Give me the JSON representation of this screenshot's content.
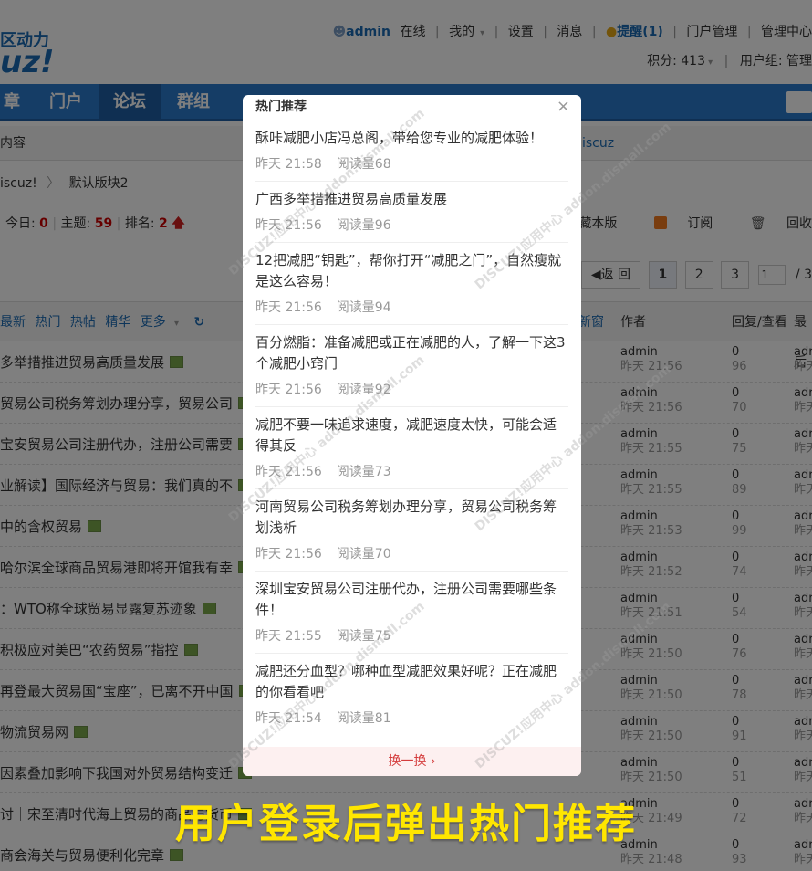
{
  "header": {
    "logo_top": "区动力",
    "logo_bottom": "uz!",
    "user": "admin",
    "status": "在线",
    "links": [
      "我的",
      "设置",
      "消息",
      "提醒(1)",
      "门户管理",
      "管理中心"
    ],
    "points": "积分: 413",
    "usergroup": "用户组: 管理"
  },
  "nav": {
    "items": [
      "章",
      "门户",
      "论坛",
      "群组"
    ],
    "sub": "内容",
    "sub_right": "iscuz"
  },
  "breadcrumb": [
    "iscuz!",
    "默认版块2"
  ],
  "stats": {
    "today_label": "今日:",
    "today": "0",
    "topics_label": "主题:",
    "topics": "59",
    "rank_label": "排名:",
    "rank": "2"
  },
  "actions": [
    "收藏本版",
    "订阅",
    "回收"
  ],
  "pager": {
    "back": "返 回",
    "pages": [
      "1",
      "2",
      "3"
    ],
    "input": "1",
    "total": "/ 3"
  },
  "list": {
    "filters": [
      "最新",
      "热门",
      "热帖",
      "精华",
      "更多"
    ],
    "cols": {
      "newwin": "新窗",
      "author": "作者",
      "replies": "回复/查看",
      "last": "最后"
    },
    "rows": [
      {
        "title": "多举措推进贸易高质量发展",
        "author": "admin",
        "time": "昨天 21:56",
        "r": "0",
        "v": "96",
        "last1": "adr",
        "last2": "昨天"
      },
      {
        "title": "贸易公司税务筹划办理分享，贸易公司",
        "author": "admin",
        "time": "昨天 21:56",
        "r": "0",
        "v": "70",
        "last1": "adr",
        "last2": "昨天"
      },
      {
        "title": "宝安贸易公司注册代办，注册公司需要",
        "author": "admin",
        "time": "昨天 21:55",
        "r": "0",
        "v": "75",
        "last1": "adr",
        "last2": "昨天"
      },
      {
        "title": "业解读】国际经济与贸易：我们真的不",
        "author": "admin",
        "time": "昨天 21:55",
        "r": "0",
        "v": "89",
        "last1": "adr",
        "last2": "昨天"
      },
      {
        "title": "中的含权贸易",
        "author": "admin",
        "time": "昨天 21:53",
        "r": "0",
        "v": "99",
        "last1": "adr",
        "last2": "昨天"
      },
      {
        "title": "哈尔滨全球商品贸易港即将开馆我有幸",
        "author": "admin",
        "time": "昨天 21:52",
        "r": "0",
        "v": "74",
        "last1": "adr",
        "last2": "昨天"
      },
      {
        "title": "：WTO称全球贸易显露复苏迹象",
        "author": "admin",
        "time": "昨天 21:51",
        "r": "0",
        "v": "54",
        "last1": "adr",
        "last2": "昨天"
      },
      {
        "title": "积极应对美巴“农药贸易”指控",
        "author": "admin",
        "time": "昨天 21:50",
        "r": "0",
        "v": "76",
        "last1": "adr",
        "last2": "昨天"
      },
      {
        "title": "再登最大贸易国“宝座”，已离不开中国",
        "author": "admin",
        "time": "昨天 21:50",
        "r": "0",
        "v": "78",
        "last1": "adr",
        "last2": "昨天"
      },
      {
        "title": "物流贸易网",
        "author": "admin",
        "time": "昨天 21:50",
        "r": "0",
        "v": "91",
        "last1": "adr",
        "last2": "昨天"
      },
      {
        "title": "因素叠加影响下我国对外贸易结构变迁",
        "author": "admin",
        "time": "昨天 21:50",
        "r": "0",
        "v": "51",
        "last1": "adr",
        "last2": "昨天"
      },
      {
        "title": "讨｜宋至清时代海上贸易的商品与货币",
        "author": "admin",
        "time": "昨天 21:49",
        "r": "0",
        "v": "72",
        "last1": "adr",
        "last2": "昨天"
      },
      {
        "title": "商会海关与贸易便利化完章",
        "author": "admin",
        "time": "昨天 21:48",
        "r": "0",
        "v": "93",
        "last1": "adr",
        "last2": "昨天"
      }
    ]
  },
  "modal": {
    "title": "热门推荐",
    "close": "×",
    "items": [
      {
        "text": "酥咔减肥小店冯总阁，带给您专业的减肥体验！",
        "time": "昨天 21:58",
        "reads": "阅读量68"
      },
      {
        "text": "广西多举措推进贸易高质量发展",
        "time": "昨天 21:56",
        "reads": "阅读量96"
      },
      {
        "text": "12把减肥“钥匙”，帮你打开“减肥之门”，自然瘦就是这么容易！",
        "time": "昨天 21:56",
        "reads": "阅读量94"
      },
      {
        "text": "百分燃脂：准备减肥或正在减肥的人，了解一下这3个减肥小窍门",
        "time": "昨天 21:56",
        "reads": "阅读量92"
      },
      {
        "text": "减肥不要一味追求速度，减肥速度太快，可能会适得其反",
        "time": "昨天 21:56",
        "reads": "阅读量73"
      },
      {
        "text": "河南贸易公司税务筹划办理分享，贸易公司税务筹划浅析",
        "time": "昨天 21:56",
        "reads": "阅读量70"
      },
      {
        "text": "深圳宝安贸易公司注册代办，注册公司需要哪些条件！",
        "time": "昨天 21:55",
        "reads": "阅读量75"
      },
      {
        "text": "减肥还分血型？哪种血型减肥效果好呢？正在减肥的你看看吧",
        "time": "昨天 21:54",
        "reads": "阅读量81"
      }
    ],
    "refresh": "换一换 ›"
  },
  "watermark": "DISCUZ!应用中心 addon.dismall.com",
  "caption": "用户登录后弹出热门推荐"
}
